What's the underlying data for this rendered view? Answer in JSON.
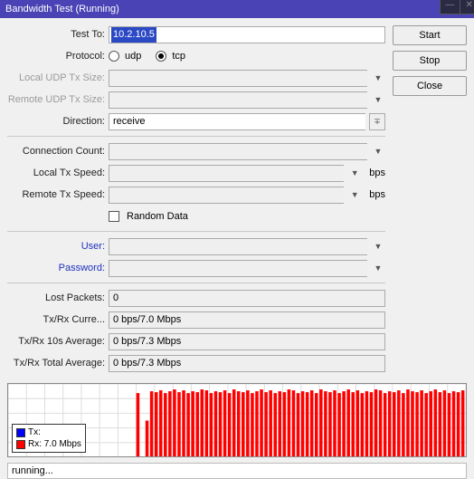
{
  "window": {
    "title": "Bandwidth Test (Running)"
  },
  "buttons": {
    "start": "Start",
    "stop": "Stop",
    "close": "Close"
  },
  "labels": {
    "test_to": "Test To:",
    "protocol": "Protocol:",
    "local_udp": "Local UDP Tx Size:",
    "remote_udp": "Remote UDP Tx Size:",
    "direction": "Direction:",
    "conn_count": "Connection Count:",
    "local_tx": "Local Tx Speed:",
    "remote_tx": "Remote Tx Speed:",
    "random": "Random Data",
    "user": "User:",
    "password": "Password:",
    "lost": "Lost Packets:",
    "txrx_curr": "Tx/Rx Curre...",
    "txrx_10s": "Tx/Rx 10s Average:",
    "txrx_total": "Tx/Rx Total Average:"
  },
  "fields": {
    "test_to": "10.2.10.5",
    "protocol_udp": "udp",
    "protocol_tcp": "tcp",
    "protocol_selected": "tcp",
    "local_udp": "",
    "remote_udp": "",
    "direction": "receive",
    "conn_count": "",
    "local_tx": "",
    "remote_tx": "",
    "speed_unit": "bps",
    "random_checked": false,
    "user": "",
    "password": "",
    "lost": "0",
    "txrx_curr": "0 bps/7.0 Mbps",
    "txrx_10s": "0 bps/7.3 Mbps",
    "txrx_total": "0 bps/7.3 Mbps"
  },
  "legend": {
    "tx_label": "Tx:",
    "rx_label": "Rx:  7.0 Mbps",
    "tx_color": "#0000ff",
    "rx_color": "#ff0000"
  },
  "status": "running...",
  "chart_data": {
    "type": "bar",
    "title": "",
    "xlabel": "",
    "ylabel": "",
    "ylim": [
      0,
      8
    ],
    "series": [
      {
        "name": "Tx",
        "color": "#0000ff",
        "values": [
          0,
          0,
          0,
          0,
          0,
          0,
          0,
          0,
          0,
          0,
          0,
          0,
          0,
          0,
          0,
          0,
          0,
          0,
          0,
          0,
          0,
          0,
          0,
          0,
          0,
          0,
          0,
          0,
          0,
          0,
          0,
          0,
          0,
          0,
          0,
          0,
          0,
          0,
          0,
          0,
          0,
          0,
          0,
          0,
          0,
          0,
          0,
          0,
          0,
          0,
          0,
          0,
          0,
          0,
          0,
          0,
          0,
          0,
          0,
          0,
          0,
          0,
          0,
          0,
          0,
          0,
          0,
          0,
          0,
          0,
          0,
          0,
          0,
          0,
          0,
          0,
          0,
          0,
          0,
          0,
          0,
          0,
          0,
          0,
          0,
          0,
          0,
          0,
          0,
          0,
          0,
          0,
          0,
          0,
          0,
          0,
          0,
          0,
          0,
          0
        ]
      },
      {
        "name": "Rx",
        "color": "#ff0000",
        "values": [
          0,
          0,
          0,
          0,
          0,
          0,
          0,
          0,
          0,
          0,
          0,
          0,
          0,
          0,
          0,
          0,
          0,
          0,
          0,
          0,
          0,
          0,
          0,
          0,
          0,
          0,
          0,
          0,
          7.0,
          0,
          4.0,
          7.2,
          7.1,
          7.3,
          7.0,
          7.2,
          7.4,
          7.1,
          7.3,
          7.0,
          7.2,
          7.1,
          7.4,
          7.3,
          7.0,
          7.2,
          7.1,
          7.3,
          7.0,
          7.4,
          7.2,
          7.1,
          7.3,
          7.0,
          7.2,
          7.4,
          7.1,
          7.3,
          7.0,
          7.2,
          7.1,
          7.4,
          7.3,
          7.0,
          7.2,
          7.1,
          7.3,
          7.0,
          7.4,
          7.2,
          7.1,
          7.3,
          7.0,
          7.2,
          7.4,
          7.1,
          7.3,
          7.0,
          7.2,
          7.1,
          7.4,
          7.3,
          7.0,
          7.2,
          7.1,
          7.3,
          7.0,
          7.4,
          7.2,
          7.1,
          7.3,
          7.0,
          7.2,
          7.4,
          7.1,
          7.3,
          7.0,
          7.2,
          7.1,
          7.3
        ]
      }
    ]
  }
}
